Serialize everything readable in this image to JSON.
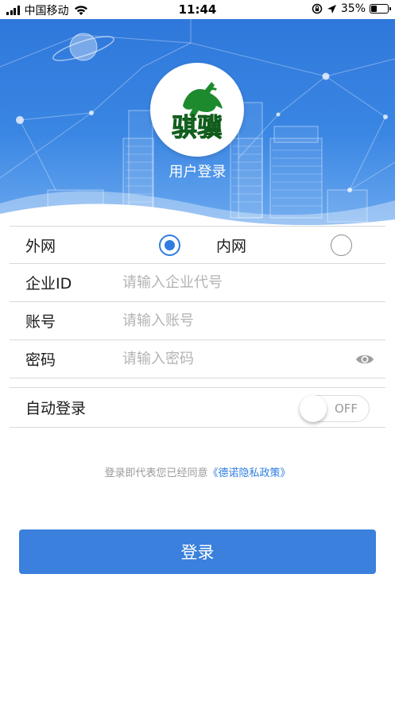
{
  "status_bar": {
    "carrier": "中国移动",
    "time": "11:44",
    "battery_percent": "35%",
    "battery_level": 0.35,
    "icons": [
      "signal-icon",
      "wifi-icon",
      "screen-lock-icon",
      "location-arrow-icon",
      "battery-icon"
    ]
  },
  "header": {
    "logo_text": "骐骥",
    "title": "用户登录",
    "colors": {
      "banner": "#3a86e3",
      "logo_green": "#1e8a2e"
    }
  },
  "form": {
    "network": {
      "outer_label": "外网",
      "inner_label": "内网",
      "selected": "外网"
    },
    "company": {
      "label": "企业ID",
      "value": "",
      "placeholder": "请输入企业代号"
    },
    "account": {
      "label": "账号",
      "value": "",
      "placeholder": "请输入账号"
    },
    "password": {
      "label": "密码",
      "value": "",
      "placeholder": "请输入密码"
    },
    "auto_login": {
      "label": "自动登录",
      "state": "OFF"
    }
  },
  "agreement": {
    "prefix": "登录即代表您已经同意",
    "link": "《德诺隐私政策》"
  },
  "login_button": {
    "label": "登录",
    "color": "#3a80dc"
  }
}
